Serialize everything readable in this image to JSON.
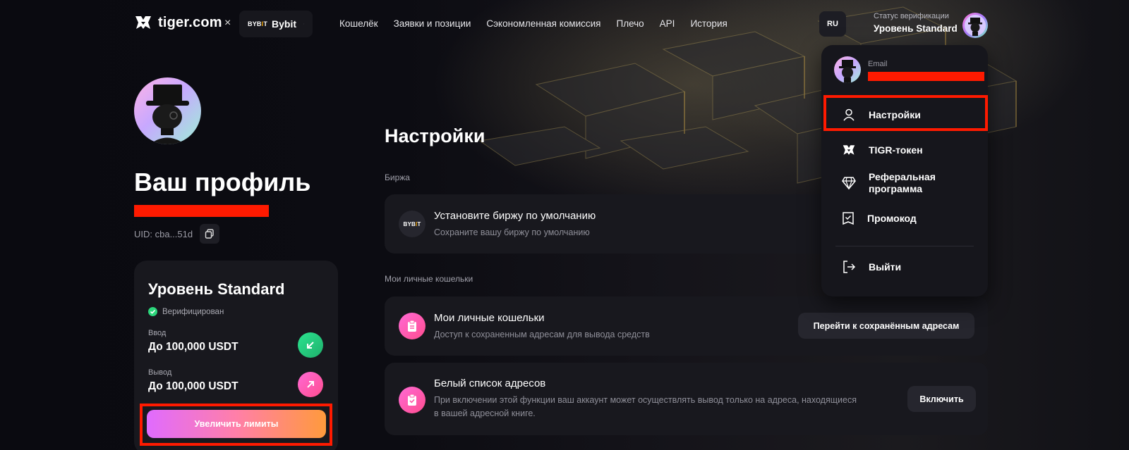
{
  "header": {
    "brand": "tiger.com",
    "separator": "×",
    "exchange": {
      "badge_prefix": "BYB",
      "badge_accent": "I",
      "badge_suffix": "T",
      "name": "Bybit"
    },
    "nav": [
      "Кошелёк",
      "Заявки и позиции",
      "Сэкономленная комиссия",
      "Плечо",
      "API",
      "История"
    ],
    "language": "RU",
    "verification": {
      "label": "Статус верификации",
      "value": "Уровень Standard"
    }
  },
  "profile": {
    "title": "Ваш профиль",
    "uid": "UID: cba...51d"
  },
  "level_card": {
    "title": "Уровень Standard",
    "status": "Верифицирован",
    "deposit_label": "Ввод",
    "deposit_value": "До 100,000 USDT",
    "withdraw_label": "Вывод",
    "withdraw_value": "До 100,000 USDT",
    "increase_button": "Увеличить лимиты"
  },
  "main": {
    "title": "Настройки",
    "exchange_section": "Биржа",
    "default_exchange": {
      "badge_prefix": "BYB",
      "badge_accent": "I",
      "badge_suffix": "T",
      "title": "Установите биржу по умолчанию",
      "subtitle": "Сохраните вашу биржу по умолчанию"
    },
    "wallets_section": "Мои личные кошельки",
    "wallets": {
      "title": "Мои личные кошельки",
      "subtitle": "Доступ к сохраненным адресам для вывода средств",
      "action": "Перейти к сохранённым адресам"
    },
    "whitelist": {
      "title": "Белый список адресов",
      "subtitle_line1": "При включении этой функции ваш аккаунт может осуществлять вывод только на адреса, находящиеся",
      "subtitle_line2": "в вашей адресной книге.",
      "action": "Включить"
    }
  },
  "dropdown": {
    "email_label": "Email",
    "items": {
      "settings": "Настройки",
      "token": "TIGR-токен",
      "referral_line1": "Реферальная",
      "referral_line2": "программа",
      "promo": "Промокод",
      "logout": "Выйти"
    }
  },
  "colors": {
    "accent_red": "#ff1a00",
    "bybit_orange": "#f7a600",
    "verified_green": "#2bd67b",
    "gradient_start": "#e06bff",
    "gradient_end": "#ff9a3c"
  }
}
